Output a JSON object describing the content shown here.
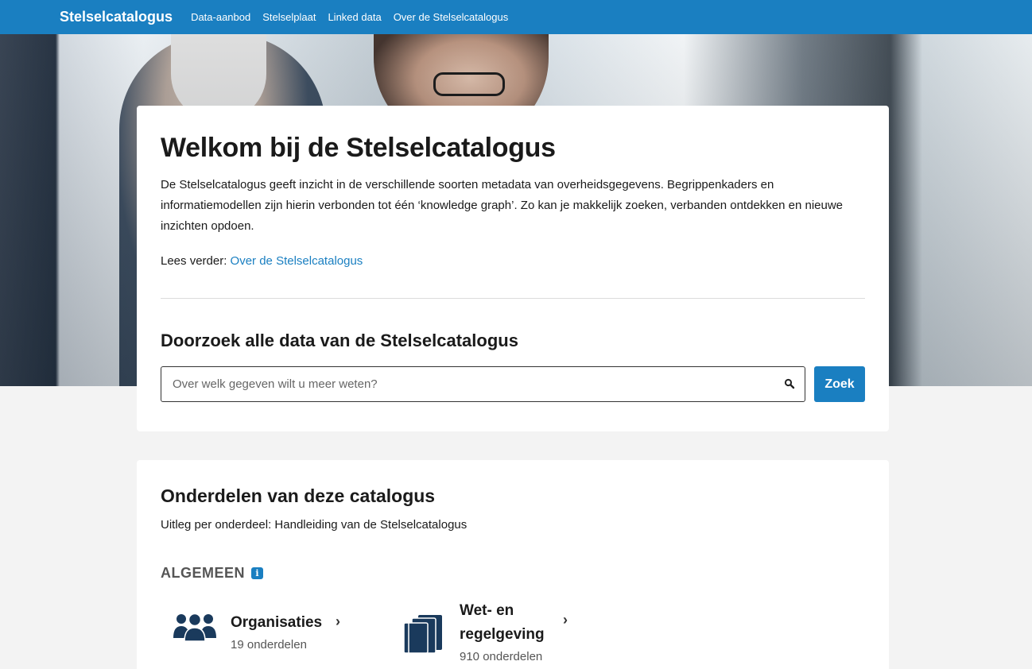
{
  "nav": {
    "brand": "Stelselcatalogus",
    "links": [
      "Data-aanbod",
      "Stelselplaat",
      "Linked data",
      "Over de Stelselcatalogus"
    ]
  },
  "welcome": {
    "title": "Welkom bij de Stelselcatalogus",
    "intro": "De Stelselcatalogus geeft inzicht in de verschillende soorten metadata van overheidsgegevens. Begrippenkaders en informatiemodellen zijn hierin verbonden tot één ‘knowledge graph’. Zo kan je makkelijk zoeken, verbanden ontdekken en nieuwe inzichten opdoen.",
    "readmore_prefix": "Lees verder: ",
    "readmore_link": "Over de Stelselcatalogus"
  },
  "search": {
    "title": "Doorzoek alle data van de Stelselcatalogus",
    "placeholder": "Over welk gegeven wilt u meer weten?",
    "value": "",
    "button": "Zoek",
    "icon": "search-icon"
  },
  "parts": {
    "title": "Onderdelen van deze catalogus",
    "subtitle": "Uitleg per onderdeel: Handleiding van de Stelselcatalogus",
    "section_label": "ALGEMEEN",
    "info_glyph": "i",
    "tiles": [
      {
        "name": "Organisaties",
        "count": "19 onderdelen",
        "icon": "people-group-icon"
      },
      {
        "name_line1": "Wet- en",
        "name_line2": "regelgeving",
        "count": "910 onderdelen",
        "icon": "law-books-icon"
      }
    ]
  },
  "colors": {
    "accent": "#1a7fc1",
    "page_bg": "#f3f3f3",
    "icon_dark": "#1a3a5c"
  }
}
